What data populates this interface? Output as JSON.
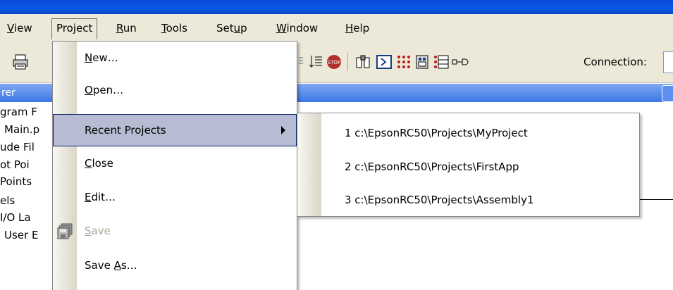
{
  "menubar": {
    "items": [
      {
        "pre": "",
        "u": "V",
        "post": "iew"
      },
      {
        "pre": "Pro",
        "u": "j",
        "post": "ect"
      },
      {
        "pre": "",
        "u": "R",
        "post": "un"
      },
      {
        "pre": "",
        "u": "T",
        "post": "ools"
      },
      {
        "pre": "Set",
        "u": "u",
        "post": "p"
      },
      {
        "pre": "",
        "u": "W",
        "post": "indow"
      },
      {
        "pre": "",
        "u": "H",
        "post": "elp"
      }
    ]
  },
  "toolbar": {
    "connection_label": "Connection:"
  },
  "explorer": {
    "header": "rer",
    "items": [
      "gram F",
      "Main.p",
      "ude Fil",
      "ot Poi",
      "Points",
      "els",
      "I/O La",
      "User E"
    ]
  },
  "project_menu": {
    "items": [
      {
        "pre": "",
        "u": "N",
        "post": "ew…",
        "enabled": true
      },
      {
        "pre": "",
        "u": "O",
        "post": "pen…",
        "enabled": true
      },
      {
        "pre": "Recent Projects",
        "u": "",
        "post": "",
        "enabled": true,
        "submenu": true,
        "highlighted": true
      },
      {
        "pre": "",
        "u": "C",
        "post": "lose",
        "enabled": true
      },
      {
        "pre": "",
        "u": "E",
        "post": "dit…",
        "enabled": true
      },
      {
        "pre": "",
        "u": "S",
        "post": "ave",
        "enabled": false,
        "icon": "save-all-icon"
      },
      {
        "pre": "Save ",
        "u": "A",
        "post": "s…",
        "enabled": true
      }
    ]
  },
  "recent_projects": {
    "items": [
      "1 c:\\EpsonRC50\\Projects\\MyProject",
      "2 c:\\EpsonRC50\\Projects\\FirstApp",
      "3 c:\\EpsonRC50\\Projects\\Assembly1"
    ]
  },
  "colors": {
    "menu_bg": "#ece9d8",
    "highlight": "#b6bdd2",
    "title_blue": "#0a4cd8",
    "disabled_text": "#aca899"
  }
}
